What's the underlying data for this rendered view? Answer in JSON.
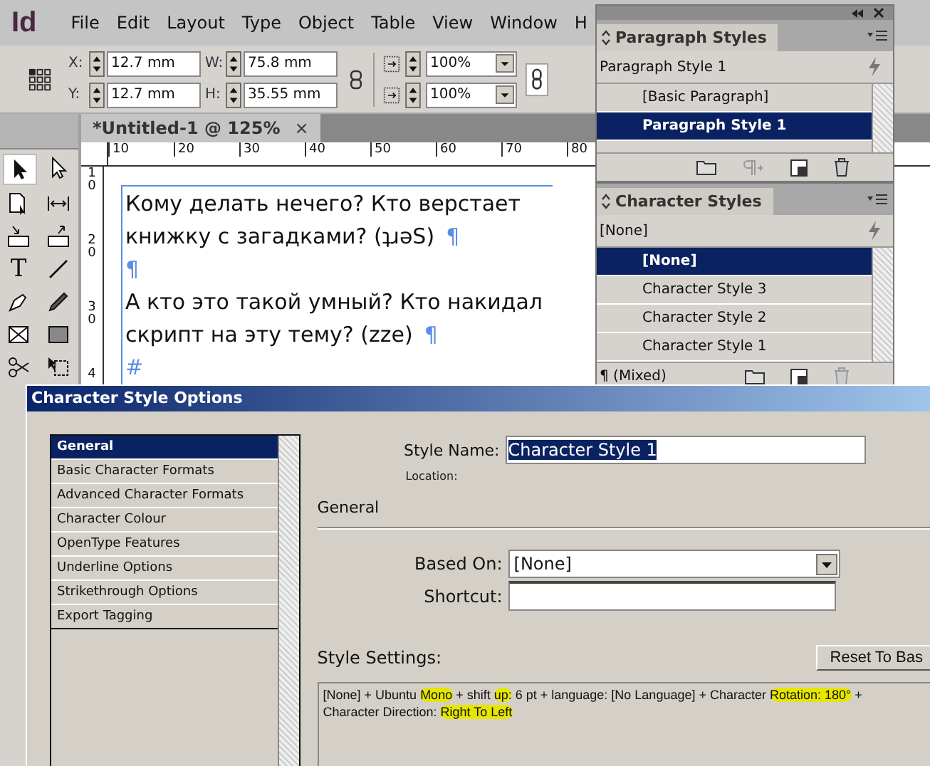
{
  "menu_bar": {
    "logo": "Id",
    "menus": [
      "File",
      "Edit",
      "Layout",
      "Type",
      "Object",
      "Table",
      "View",
      "Window",
      "H"
    ]
  },
  "control_bar": {
    "fields": [
      {
        "label": "X:",
        "value": "12.7 mm"
      },
      {
        "label": "Y:",
        "value": "12.7 mm"
      },
      {
        "label": "W:",
        "value": "75.8 mm"
      },
      {
        "label": "H:",
        "value": "35.55 mm"
      }
    ],
    "scales": [
      "100%",
      "100%"
    ]
  },
  "tools": [
    {
      "kind": "select",
      "selected": true
    },
    {
      "kind": "direct",
      "selected": false
    },
    {
      "kind": "page",
      "selected": false
    },
    {
      "kind": "gap",
      "selected": false
    },
    {
      "kind": "collector",
      "selected": false
    },
    {
      "kind": "placer",
      "selected": false
    },
    {
      "kind": "type",
      "glyph": "T",
      "selected": false
    },
    {
      "kind": "line",
      "selected": false
    },
    {
      "kind": "pen",
      "selected": false
    },
    {
      "kind": "pencil",
      "selected": false
    },
    {
      "kind": "frame",
      "selected": false
    },
    {
      "kind": "rect",
      "selected": false
    },
    {
      "kind": "scissors",
      "selected": false
    },
    {
      "kind": "transform",
      "selected": false
    }
  ],
  "document_tab": {
    "title": "*Untitled-1 @ 125%",
    "close": "×"
  },
  "ruler": {
    "horizontal": [
      "10",
      "20",
      "30",
      "40",
      "50",
      "60",
      "70",
      "80"
    ],
    "vertical": [
      "10",
      "20",
      "30",
      "4"
    ]
  },
  "document": {
    "lines": [
      {
        "text": "Кому делать нечего? Кто верстает"
      },
      {
        "text": "книжку с загадками? (ʇɹəS)",
        "mark": "¶"
      },
      {
        "mark": "¶"
      },
      {
        "text": "А кто это такой умный? Кто накидал"
      },
      {
        "text": "скрипт на эту тему? (zze)",
        "mark": "¶"
      },
      {
        "mark": "#"
      }
    ]
  },
  "paragraph_styles": {
    "title": "Paragraph Styles",
    "current": "Paragraph Style 1",
    "items": [
      {
        "label": "[Basic Paragraph]",
        "selected": false
      },
      {
        "label": "Paragraph Style 1",
        "selected": true
      }
    ]
  },
  "character_styles": {
    "title": "Character Styles",
    "current": "[None]",
    "footer": "¶ (Mixed)",
    "items": [
      {
        "label": "[None]",
        "selected": true
      },
      {
        "label": "Character Style 3",
        "selected": false
      },
      {
        "label": "Character Style 2",
        "selected": false
      },
      {
        "label": "Character Style 1",
        "selected": false
      }
    ]
  },
  "dialog": {
    "title": "Character Style Options",
    "categories": [
      {
        "label": "General",
        "selected": true
      },
      {
        "label": "Basic Character Formats",
        "selected": false
      },
      {
        "label": "Advanced Character Formats",
        "selected": false
      },
      {
        "label": "Character Colour",
        "selected": false
      },
      {
        "label": "OpenType Features",
        "selected": false
      },
      {
        "label": "Underline Options",
        "selected": false
      },
      {
        "label": "Strikethrough Options",
        "selected": false
      },
      {
        "label": "Export Tagging",
        "selected": false
      }
    ],
    "style_name_label": "Style Name:",
    "style_name": "Character Style 1",
    "location_label": "Location:",
    "section": "General",
    "based_on_label": "Based On:",
    "based_on": "[None]",
    "shortcut_label": "Shortcut:",
    "settings_label": "Style Settings:",
    "reset_button": "Reset To Bas",
    "settings": [
      {
        "text": "[None] + Ubuntu ",
        "highlight": false
      },
      {
        "text": "Mono",
        "highlight": true
      },
      {
        "text": " + shift ",
        "highlight": false
      },
      {
        "text": "up:",
        "highlight": true
      },
      {
        "text": " 6 pt + language: [No Language] + Character ",
        "highlight": false
      },
      {
        "text": "Rotation:  180°",
        "highlight": true
      },
      {
        "text": " + Character Direction: ",
        "highlight": false
      },
      {
        "text": "Right To Left",
        "highlight": true
      }
    ]
  }
}
